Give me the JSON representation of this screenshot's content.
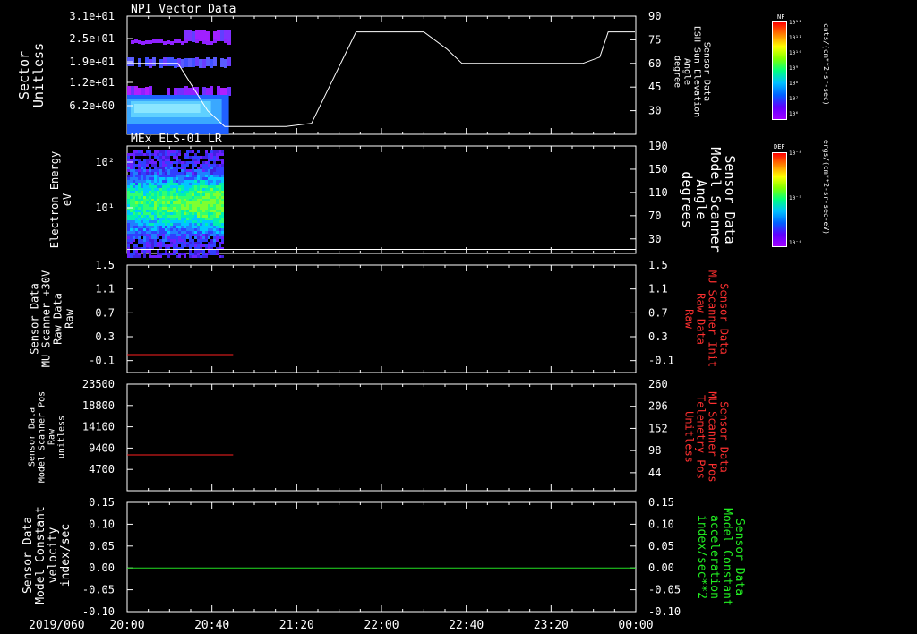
{
  "colors": {
    "background": "#000000",
    "axis": "#ffffff",
    "red_series": "#ff2020",
    "green_series": "#22dd22",
    "red_label": "#ff3030",
    "green_label": "#22ee22"
  },
  "time_axis": {
    "date_label": "2019/060",
    "ticks": [
      "20:00",
      "20:40",
      "21:20",
      "22:00",
      "22:40",
      "23:20",
      "00:00"
    ]
  },
  "colorbars": [
    {
      "title": "NF",
      "unit": "cnts/(cm**2-sr-sec)",
      "ticks": [
        "10¹²",
        "10¹¹",
        "10¹⁰",
        "10⁹",
        "10⁸",
        "10⁷",
        "10⁶"
      ]
    },
    {
      "title": "DEF",
      "unit": "ergs/(cm**2-sr-sec-eV)",
      "ticks": [
        "10⁻⁴",
        "10⁻⁵",
        "10⁻⁶"
      ]
    }
  ],
  "chart_data": [
    {
      "type": "heatmap",
      "title": "NPI Vector Data",
      "ylabel": [
        "Sector",
        "Unitless"
      ],
      "y_ticks": [
        "3.1e+01",
        "2.5e+01",
        "1.9e+01",
        "1.2e+01",
        "6.2e+00"
      ],
      "right_ylabel": [
        "Sensor Data",
        "ESH Sun Elevation",
        "Angle",
        "degree"
      ],
      "right_ylim": [
        15,
        90
      ],
      "right_ticks": [
        90,
        75,
        60,
        45,
        30
      ],
      "heatmap_time_range": [
        "20:00",
        "20:48"
      ],
      "overlay_line": {
        "name": "ESH Sun Elevation Angle",
        "x": [
          "20:00",
          "20:24",
          "20:38",
          "20:46",
          "21:00",
          "21:15",
          "21:27",
          "21:48",
          "22:20",
          "22:31",
          "22:38",
          "23:30",
          "23:35",
          "23:43",
          "23:47",
          "23:52",
          "24:00"
        ],
        "y": [
          60,
          60,
          30,
          20,
          20,
          20,
          22,
          80,
          80,
          69,
          60,
          60,
          60,
          64,
          80,
          80,
          80
        ]
      }
    },
    {
      "type": "heatmap",
      "title": "MEx ELS-01 LR",
      "ylabel": [
        "Electron Energy",
        "eV"
      ],
      "y_ticks": [
        "10²",
        "10¹"
      ],
      "right_ylabel": [
        "Sensor Data",
        "Model Scanner",
        "Angle",
        "degrees"
      ],
      "right_ylim": [
        5,
        190
      ],
      "right_ticks": [
        190,
        150,
        110,
        70,
        30
      ],
      "heatmap_time_range": [
        "20:00",
        "20:45"
      ],
      "overlay_line": {
        "name": "Model Scanner Angle",
        "x": [
          "20:00",
          "24:00"
        ],
        "y": [
          12,
          12
        ]
      }
    },
    {
      "type": "line",
      "ylabel": [
        "Sensor Data",
        "MU Scanner +30V",
        "Raw Data",
        "Raw"
      ],
      "ylim": [
        -0.3,
        1.5
      ],
      "y_ticks": [
        1.5,
        1.1,
        0.7,
        0.3,
        -0.1
      ],
      "right_ylabel": [
        "Sensor Data",
        "MU Scanner Init",
        "Raw Data",
        "Raw"
      ],
      "series": [
        {
          "color": "red",
          "x": [
            "20:00",
            "20:50"
          ],
          "y": [
            0,
            0
          ]
        }
      ]
    },
    {
      "type": "line",
      "ylabel": [
        "Sensor Data",
        "Model Scanner Pos",
        "Raw",
        "unitless"
      ],
      "ylim": [
        0,
        23500
      ],
      "y_ticks": [
        23500,
        18800,
        14100,
        9400,
        4700
      ],
      "right_ylabel": [
        "Sensor Data",
        "MU Scanner Pos",
        "Telemetry Pos",
        "Unitless"
      ],
      "right_ylim": [
        0,
        260
      ],
      "right_ticks": [
        260,
        206,
        152,
        98,
        44
      ],
      "series": [
        {
          "color": "red",
          "x": [
            "20:00",
            "20:50"
          ],
          "y": [
            7900,
            7900
          ]
        }
      ]
    },
    {
      "type": "line",
      "ylabel": [
        "Sensor Data",
        "Model Constant",
        "velocity",
        "index/sec"
      ],
      "ylim": [
        -0.1,
        0.15
      ],
      "y_ticks": [
        "0.15",
        "0.10",
        "0.05",
        "0.00",
        "-0.05",
        "-0.10"
      ],
      "right_ylabel": [
        "Sensor Data",
        "Model Constant",
        "acceleration",
        "index/sec**2"
      ],
      "right_ticks": [
        "0.15",
        "0.10",
        "0.05",
        "0.00",
        "-0.05",
        "-0.10"
      ],
      "series": [
        {
          "color": "green",
          "x": [
            "20:00",
            "24:00"
          ],
          "y": [
            0,
            0
          ]
        }
      ]
    }
  ]
}
